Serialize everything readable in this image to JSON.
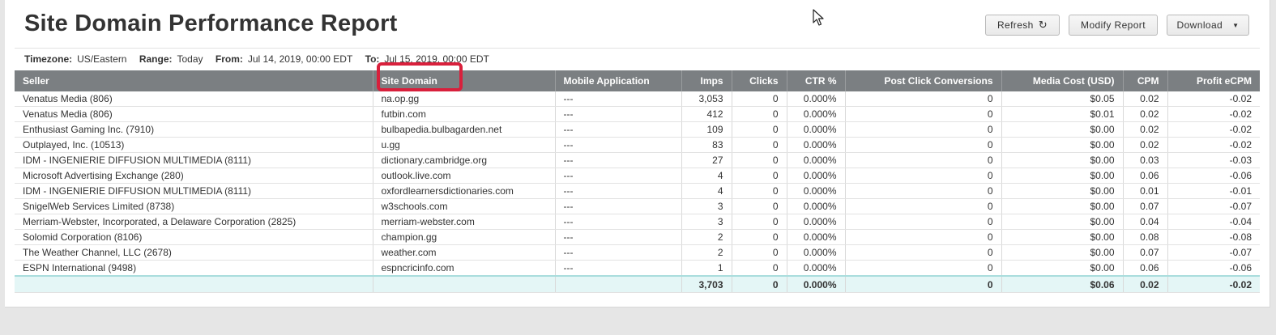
{
  "page": {
    "title": "Site Domain Performance Report"
  },
  "toolbar": {
    "refresh_label": "Refresh",
    "refresh_icon": "↻",
    "modify_label": "Modify Report",
    "download_label": "Download",
    "download_caret": "▼"
  },
  "meta": {
    "timezone_label": "Timezone:",
    "timezone_value": "US/Eastern",
    "range_label": "Range:",
    "range_value": "Today",
    "from_label": "From:",
    "from_value": "Jul 14, 2019, 00:00 EDT",
    "to_label": "To:",
    "to_value": "Jul 15, 2019, 00:00 EDT"
  },
  "table": {
    "headers": [
      "Seller",
      "Site Domain",
      "Mobile Application",
      "Imps",
      "Clicks",
      "CTR %",
      "Post Click Conversions",
      "Media Cost (USD)",
      "CPM",
      "Profit eCPM"
    ],
    "rows": [
      [
        "Venatus Media (806)",
        "na.op.gg",
        "---",
        "3,053",
        "0",
        "0.000%",
        "0",
        "$0.05",
        "0.02",
        "-0.02"
      ],
      [
        "Venatus Media (806)",
        "futbin.com",
        "---",
        "412",
        "0",
        "0.000%",
        "0",
        "$0.01",
        "0.02",
        "-0.02"
      ],
      [
        "Enthusiast Gaming Inc. (7910)",
        "bulbapedia.bulbagarden.net",
        "---",
        "109",
        "0",
        "0.000%",
        "0",
        "$0.00",
        "0.02",
        "-0.02"
      ],
      [
        "Outplayed, Inc. (10513)",
        "u.gg",
        "---",
        "83",
        "0",
        "0.000%",
        "0",
        "$0.00",
        "0.02",
        "-0.02"
      ],
      [
        "IDM - INGENIERIE DIFFUSION MULTIMEDIA (8111)",
        "dictionary.cambridge.org",
        "---",
        "27",
        "0",
        "0.000%",
        "0",
        "$0.00",
        "0.03",
        "-0.03"
      ],
      [
        "Microsoft Advertising Exchange (280)",
        "outlook.live.com",
        "---",
        "4",
        "0",
        "0.000%",
        "0",
        "$0.00",
        "0.06",
        "-0.06"
      ],
      [
        "IDM - INGENIERIE DIFFUSION MULTIMEDIA (8111)",
        "oxfordlearnersdictionaries.com",
        "---",
        "4",
        "0",
        "0.000%",
        "0",
        "$0.00",
        "0.01",
        "-0.01"
      ],
      [
        "SnigelWeb Services Limited (8738)",
        "w3schools.com",
        "---",
        "3",
        "0",
        "0.000%",
        "0",
        "$0.00",
        "0.07",
        "-0.07"
      ],
      [
        "Merriam-Webster, Incorporated, a Delaware Corporation (2825)",
        "merriam-webster.com",
        "---",
        "3",
        "0",
        "0.000%",
        "0",
        "$0.00",
        "0.04",
        "-0.04"
      ],
      [
        "Solomid Corporation (8106)",
        "champion.gg",
        "---",
        "2",
        "0",
        "0.000%",
        "0",
        "$0.00",
        "0.08",
        "-0.08"
      ],
      [
        "The Weather Channel, LLC (2678)",
        "weather.com",
        "---",
        "2",
        "0",
        "0.000%",
        "0",
        "$0.00",
        "0.07",
        "-0.07"
      ],
      [
        "ESPN International (9498)",
        "espncricinfo.com",
        "---",
        "1",
        "0",
        "0.000%",
        "0",
        "$0.00",
        "0.06",
        "-0.06"
      ]
    ],
    "totals": [
      "",
      "",
      "",
      "3,703",
      "0",
      "0.000%",
      "0",
      "$0.06",
      "0.02",
      "-0.02"
    ]
  },
  "colors": {
    "header_bg": "#7b7f82",
    "total_bg": "#e4f6f6",
    "highlight": "#d8203c"
  },
  "icons": {
    "refresh": "refresh-icon",
    "download_caret": "chevron-down-icon",
    "cursor": "mouse-pointer-icon"
  }
}
